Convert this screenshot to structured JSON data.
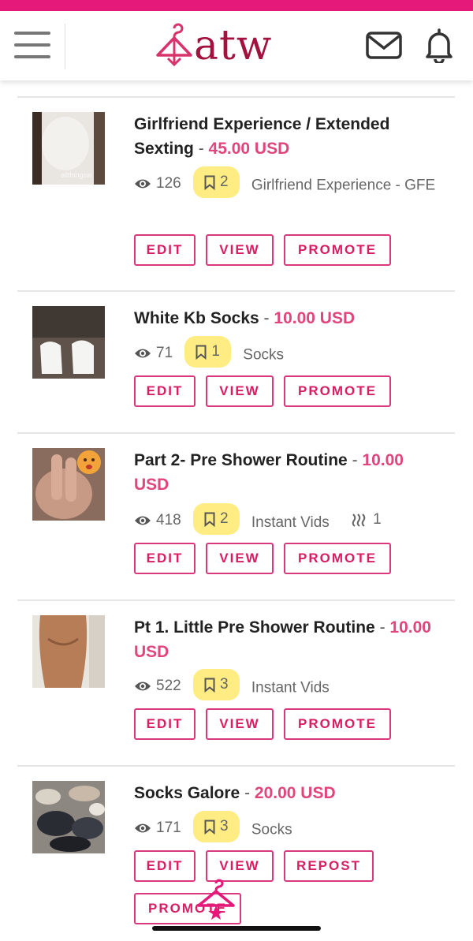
{
  "header": {
    "logo_text": "atw",
    "icons": [
      "menu-icon",
      "hanger-logo-icon",
      "mail-icon",
      "bell-icon"
    ],
    "accent": "#e5197a",
    "brand": "#a3123f"
  },
  "listings": [
    {
      "title": "Girlfriend Experience / Extended Sexting",
      "price": "45.00 USD",
      "views": "126",
      "saves": "2",
      "category": "Girlfriend Experience - GFE",
      "buttons": [
        "EDIT",
        "VIEW",
        "PROMOTE"
      ],
      "thumb_watermark": "allthingsw"
    },
    {
      "title": "White Kb Socks",
      "price": "10.00 USD",
      "views": "71",
      "saves": "1",
      "category": "Socks",
      "buttons": [
        "EDIT",
        "VIEW",
        "PROMOTE"
      ]
    },
    {
      "title": "Part 2- Pre Shower Routine",
      "price": "10.00 USD",
      "views": "418",
      "saves": "2",
      "category": "Instant Vids",
      "extra_count": "1",
      "buttons": [
        "EDIT",
        "VIEW",
        "PROMOTE"
      ]
    },
    {
      "title": "Pt 1. Little Pre Shower Routine",
      "price": "10.00 USD",
      "views": "522",
      "saves": "3",
      "category": "Instant Vids",
      "buttons": [
        "EDIT",
        "VIEW",
        "PROMOTE"
      ]
    },
    {
      "title": "Socks Galore",
      "price": "20.00 USD",
      "views": "171",
      "saves": "3",
      "category": "Socks",
      "buttons": [
        "EDIT",
        "VIEW",
        "REPOST",
        "PROMOTE"
      ]
    }
  ],
  "separator": "-"
}
